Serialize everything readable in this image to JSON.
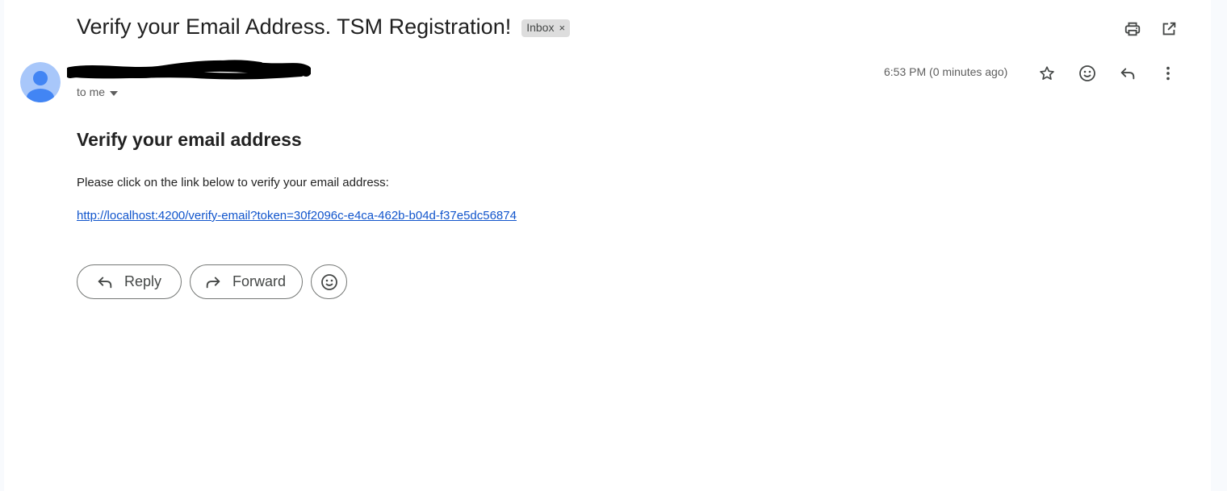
{
  "email": {
    "subject": "Verify your Email Address. TSM Registration!",
    "label": "Inbox",
    "recipient": "to me",
    "timestamp": "6:53 PM (0 minutes ago)"
  },
  "body": {
    "heading": "Verify your email address",
    "instruction": "Please click on the link below to verify your email address:",
    "link": "http://localhost:4200/verify-email?token=30f2096c-e4ca-462b-b04d-f37e5dc56874"
  },
  "actions": {
    "reply_label": "Reply",
    "forward_label": "Forward"
  },
  "icons": {
    "print": "print-icon",
    "open_new_window": "open-in-new-icon",
    "star": "star-icon",
    "emoji": "emoji-icon",
    "reply": "reply-icon",
    "more": "more-vert-icon"
  },
  "colors": {
    "link": "#1155cc",
    "avatar_bg": "#a8c7fa",
    "avatar_fg": "#4285f4",
    "chip_bg": "#dddddd"
  }
}
